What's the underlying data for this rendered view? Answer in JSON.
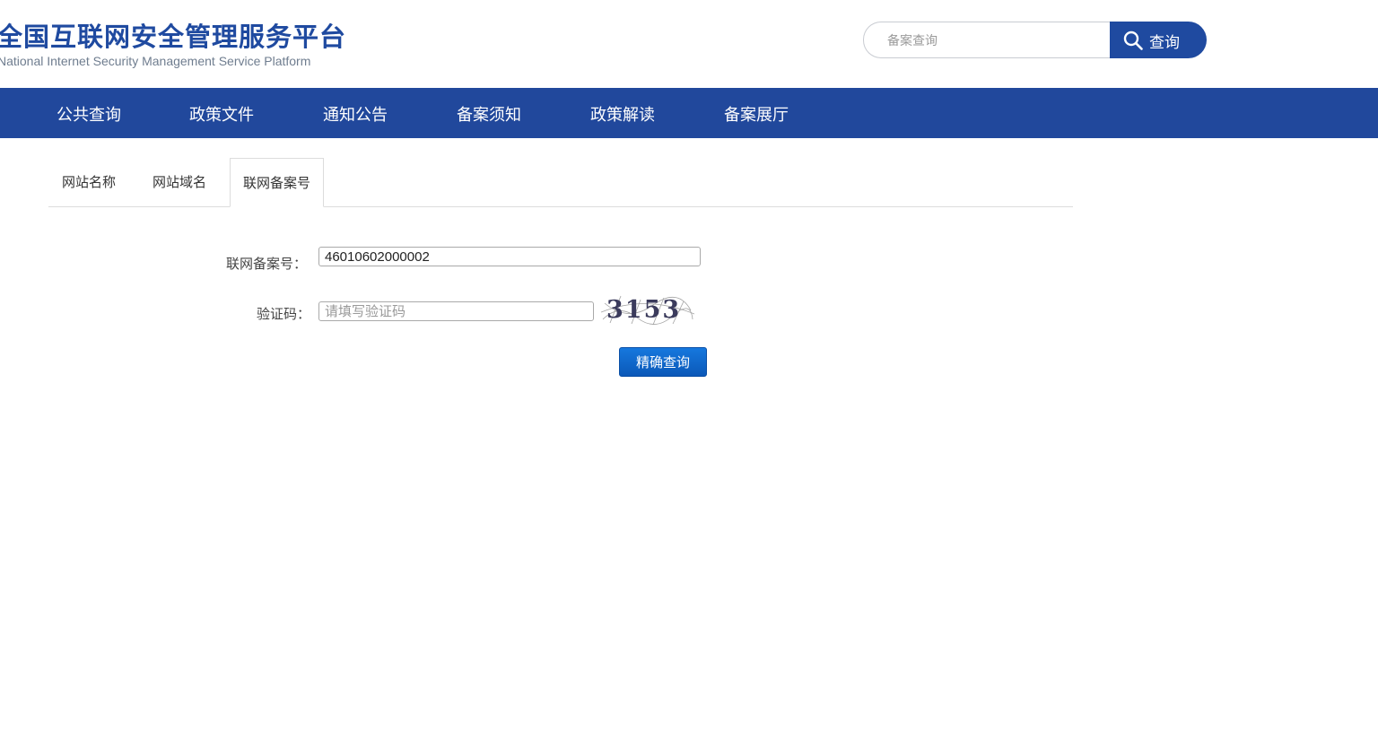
{
  "header": {
    "logo_cn": "全国互联网安全管理服务平台",
    "logo_en": "National Internet Security Management Service Platform",
    "search": {
      "placeholder": "备案查询",
      "button_label": "查询"
    }
  },
  "nav": {
    "items": [
      {
        "label": "公共查询"
      },
      {
        "label": "政策文件"
      },
      {
        "label": "通知公告"
      },
      {
        "label": "备案须知"
      },
      {
        "label": "政策解读"
      },
      {
        "label": "备案展厅"
      }
    ]
  },
  "tabs": [
    {
      "label": "网站名称",
      "active": false
    },
    {
      "label": "网站域名",
      "active": false
    },
    {
      "label": "联网备案号",
      "active": true
    }
  ],
  "form": {
    "record_label": "联网备案号：",
    "record_value": "46010602000002",
    "captcha_label": "验证码：",
    "captcha_placeholder": "请填写验证码",
    "captcha_text": "3153",
    "submit_label": "精确查询"
  },
  "colors": {
    "brand_blue": "#21489c",
    "button_blue": "#1678de"
  }
}
